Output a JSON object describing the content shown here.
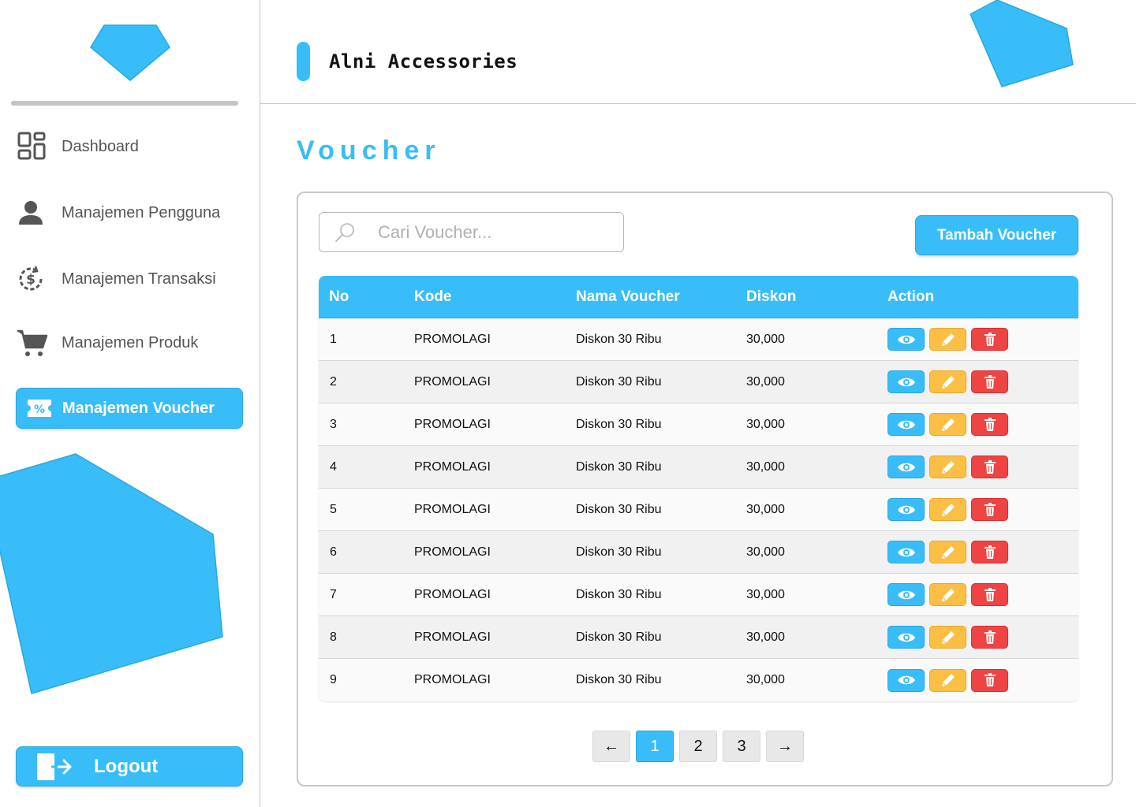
{
  "app": {
    "title": "Alni Accessories"
  },
  "sidebar": {
    "items": [
      {
        "label": "Dashboard",
        "icon": "dashboard-grid-icon",
        "active": false
      },
      {
        "label": "Manajemen Pengguna",
        "icon": "user-icon",
        "active": false
      },
      {
        "label": "Manajemen Transaksi",
        "icon": "dollar-clock-icon",
        "active": false
      },
      {
        "label": "Manajemen Produk",
        "icon": "cart-icon",
        "active": false
      },
      {
        "label": "Manajemen Voucher",
        "icon": "voucher-percent-icon",
        "active": true
      }
    ],
    "logout_label": "Logout"
  },
  "main": {
    "page_title": "Voucher",
    "search": {
      "placeholder": "Cari Voucher...",
      "value": ""
    },
    "add_button_label": "Tambah Voucher",
    "table": {
      "columns": [
        "No",
        "Kode",
        "Nama Voucher",
        "Diskon",
        "Action"
      ],
      "rows": [
        {
          "no": "1",
          "kode": "PROMOLAGI",
          "nama": "Diskon 30 Ribu",
          "diskon": "30,000"
        },
        {
          "no": "2",
          "kode": "PROMOLAGI",
          "nama": "Diskon 30 Ribu",
          "diskon": "30,000"
        },
        {
          "no": "3",
          "kode": "PROMOLAGI",
          "nama": "Diskon 30 Ribu",
          "diskon": "30,000"
        },
        {
          "no": "4",
          "kode": "PROMOLAGI",
          "nama": "Diskon 30 Ribu",
          "diskon": "30,000"
        },
        {
          "no": "5",
          "kode": "PROMOLAGI",
          "nama": "Diskon 30 Ribu",
          "diskon": "30,000"
        },
        {
          "no": "6",
          "kode": "PROMOLAGI",
          "nama": "Diskon 30 Ribu",
          "diskon": "30,000"
        },
        {
          "no": "7",
          "kode": "PROMOLAGI",
          "nama": "Diskon 30 Ribu",
          "diskon": "30,000"
        },
        {
          "no": "8",
          "kode": "PROMOLAGI",
          "nama": "Diskon 30 Ribu",
          "diskon": "30,000"
        },
        {
          "no": "9",
          "kode": "PROMOLAGI",
          "nama": "Diskon 30 Ribu",
          "diskon": "30,000"
        }
      ],
      "row_actions": [
        "view-eye-icon",
        "edit-pencil-icon",
        "delete-trash-icon"
      ]
    },
    "pagination": {
      "prev": "←",
      "pages": [
        "1",
        "2",
        "3"
      ],
      "current": "1",
      "next": "→"
    }
  },
  "colors": {
    "accent": "#38bdf8",
    "edit": "#fbbf45",
    "delete": "#ef4444",
    "muted": "#c8c8c8"
  }
}
